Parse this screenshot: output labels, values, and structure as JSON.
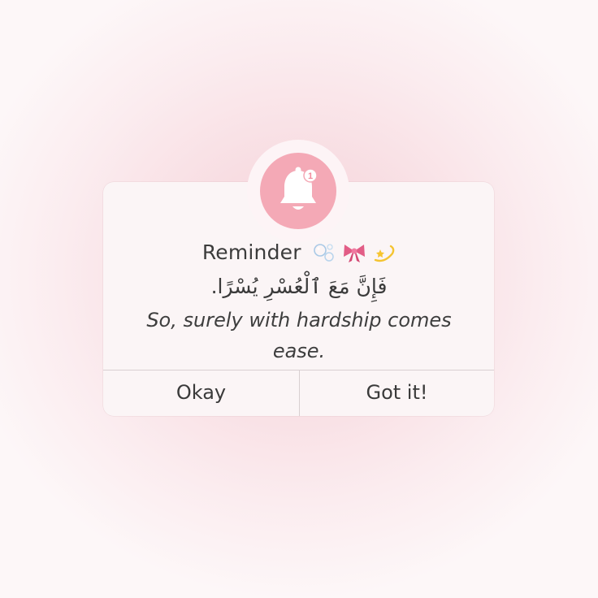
{
  "dialog": {
    "title": "Reminder",
    "title_emojis": [
      "bubbles-icon",
      "ribbon-bow-icon",
      "dizzy-star-icon"
    ],
    "arabic_text": "فَإِنَّ مَعَ ٱلْعُسْرِ يُسْرًا.",
    "translation": "So, surely with hardship comes ease.",
    "notification_count": "1",
    "icon": "bell-icon",
    "buttons": {
      "okay_label": "Okay",
      "gotit_label": "Got it!"
    }
  },
  "colors": {
    "accent": "#f4a9b6",
    "dialog_bg": "#fbf5f6",
    "text": "#3c3c3c",
    "background": "#f8dde2"
  }
}
